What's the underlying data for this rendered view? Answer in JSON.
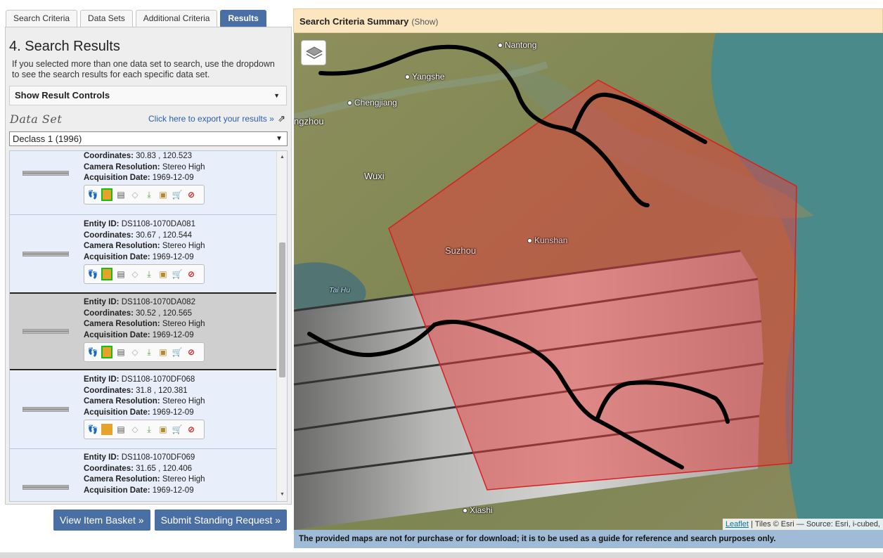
{
  "tabs": [
    {
      "label": "Search Criteria",
      "active": false
    },
    {
      "label": "Data Sets",
      "active": false
    },
    {
      "label": "Additional Criteria",
      "active": false
    },
    {
      "label": "Results",
      "active": true
    }
  ],
  "panel": {
    "heading": "4. Search Results",
    "intro": "If you selected more than one data set to search, use the dropdown to see the search results for each specific data set.",
    "controls_label": "Show Result Controls",
    "dataset_label": "Data Set",
    "export_label": "Click here to export your results »",
    "dataset_selected": "Declass 1 (1996)"
  },
  "labels": {
    "entity": "Entity ID:",
    "coords": "Coordinates:",
    "camera": "Camera Resolution:",
    "acq": "Acquisition Date:"
  },
  "results": [
    {
      "entity_id": "",
      "coordinates": "30.83 , 120.523",
      "camera": "Stereo High",
      "date": "1969-12-09",
      "selected": false,
      "overlay_on": true
    },
    {
      "entity_id": "DS1108-1070DA081",
      "coordinates": "30.67 , 120.544",
      "camera": "Stereo High",
      "date": "1969-12-09",
      "selected": false,
      "overlay_on": true
    },
    {
      "entity_id": "DS1108-1070DA082",
      "coordinates": "30.52 , 120.565",
      "camera": "Stereo High",
      "date": "1969-12-09",
      "selected": true,
      "overlay_on": true
    },
    {
      "entity_id": "DS1108-1070DF068",
      "coordinates": "31.8 , 120.381",
      "camera": "Stereo High",
      "date": "1969-12-09",
      "selected": false,
      "overlay_on": false
    },
    {
      "entity_id": "DS1108-1070DF069",
      "coordinates": "31.65 , 120.406",
      "camera": "Stereo High",
      "date": "1969-12-09",
      "selected": false,
      "overlay_on": false
    }
  ],
  "result_icons": [
    "footprint-icon",
    "overlay-icon",
    "metadata-icon",
    "compare-icon",
    "download-icon",
    "bulk-download-icon",
    "cart-icon",
    "exclude-icon"
  ],
  "buttons": {
    "basket": "View Item Basket »",
    "standing": "Submit Standing Request »"
  },
  "summary": {
    "title": "Search Criteria Summary",
    "show": "(Show)"
  },
  "map": {
    "labels": {
      "nantong": "Nantong",
      "yangshe": "Yangshe",
      "chengjiang": "Chengjiang",
      "changzhou": "ngzhou",
      "wuxi": "Wuxi",
      "suzhou": "Suzhou",
      "kunshan": "Kunshan",
      "taihu": "Tai Hu",
      "xiashi": "Xiashi"
    },
    "attribution_link": "Leaflet",
    "attribution_text": "| Tiles © Esri — Source: Esri, i-cubed,",
    "disclaimer": "The provided maps are not for purchase or for download; it is to be used as a guide for reference and search purposes only.",
    "colors": {
      "aoi_fill": "#e83c3c",
      "aoi_stroke": "#d62020",
      "water": "#3f7f86"
    }
  }
}
